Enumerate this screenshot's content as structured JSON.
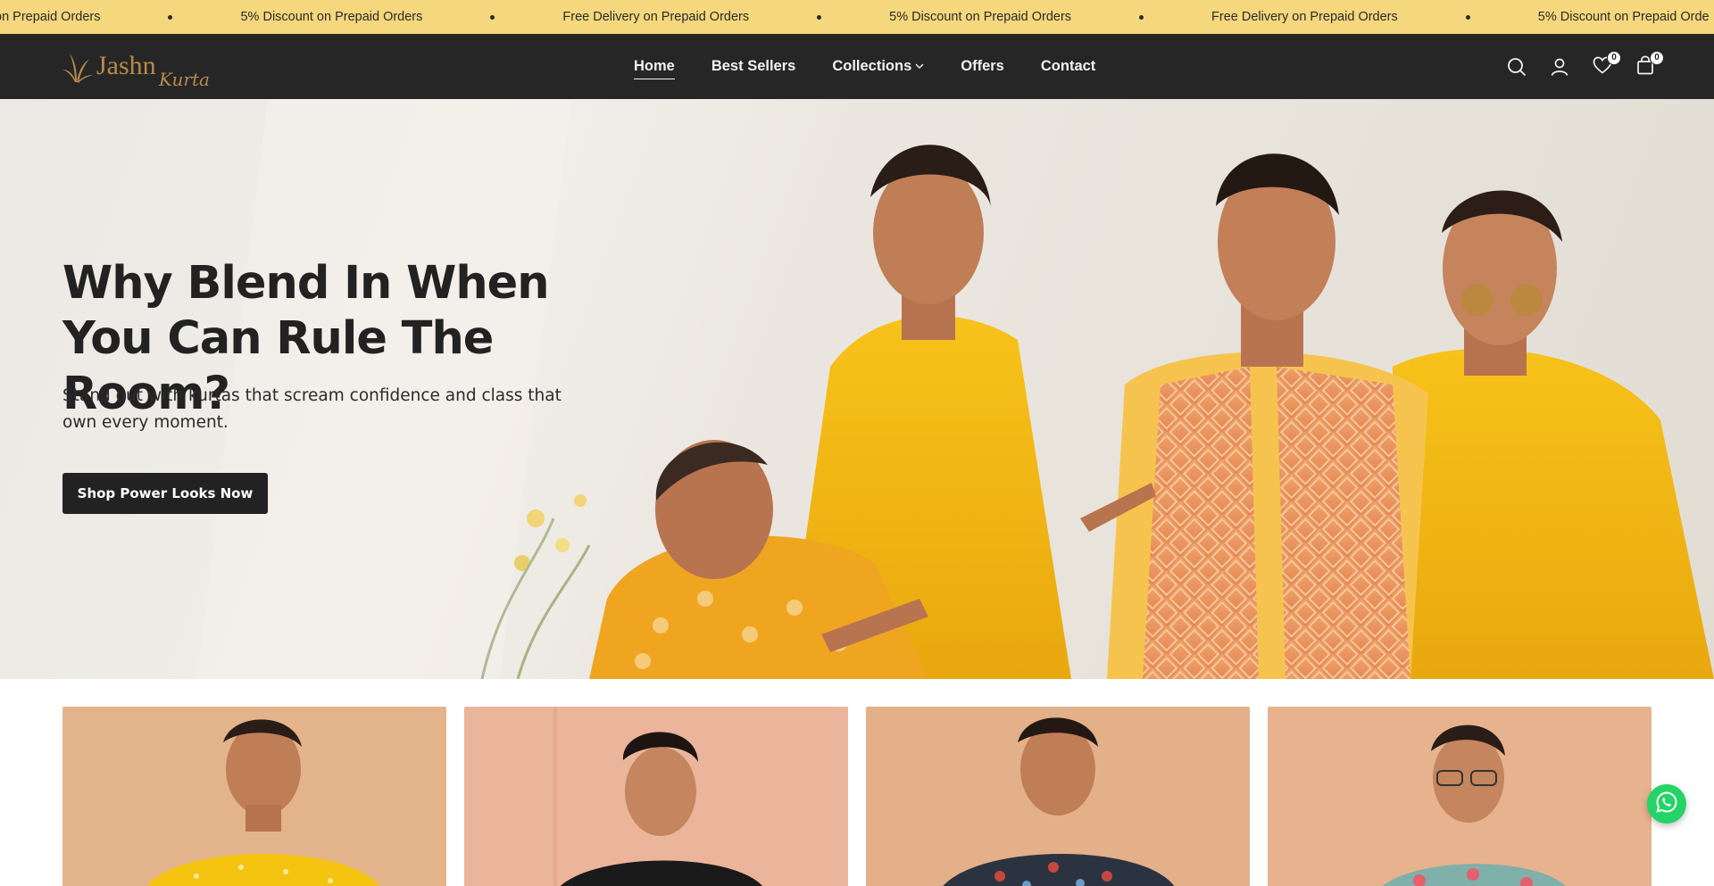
{
  "announcement": {
    "items": [
      "on Prepaid Orders",
      "5% Discount on Prepaid Orders",
      "Free Delivery on Prepaid Orders",
      "5% Discount on Prepaid Orders",
      "Free Delivery on Prepaid Orders",
      "5% Discount on Prepaid Orde"
    ],
    "background": "#f5d77d"
  },
  "header": {
    "background": "#262626",
    "logo": {
      "text_main": "Jashn",
      "text_script": "Kurta",
      "color": "#b88a4a"
    },
    "nav": [
      {
        "label": "Home",
        "active": true
      },
      {
        "label": "Best Sellers",
        "active": false
      },
      {
        "label": "Collections",
        "has_dropdown": true
      },
      {
        "label": "Offers",
        "active": false
      },
      {
        "label": "Contact",
        "active": false
      }
    ],
    "icons": {
      "search": "search-icon",
      "account": "user-icon",
      "wishlist": "heart-icon",
      "cart": "bag-icon"
    },
    "wishlist_count": "0",
    "cart_count": "0"
  },
  "hero": {
    "title": "Why Blend In When You Can Rule The Room?",
    "subtitle": "Stand out with kurtas that scream confidence and class that own every moment.",
    "cta_label": "Shop Power Looks Now",
    "image": "four-men-in-festive-kurtas"
  },
  "product_cards": [
    {
      "image": "man-in-yellow-kurta",
      "bg": "#e3b48b"
    },
    {
      "image": "man-in-black-kurta",
      "bg": "#eab59a"
    },
    {
      "image": "man-in-printed-dark-kurta",
      "bg": "#e3b08a"
    },
    {
      "image": "man-in-floral-blue-kurta",
      "bg": "#e6b38e"
    }
  ],
  "whatsapp": {
    "icon": "whatsapp-icon",
    "color": "#25d366"
  }
}
